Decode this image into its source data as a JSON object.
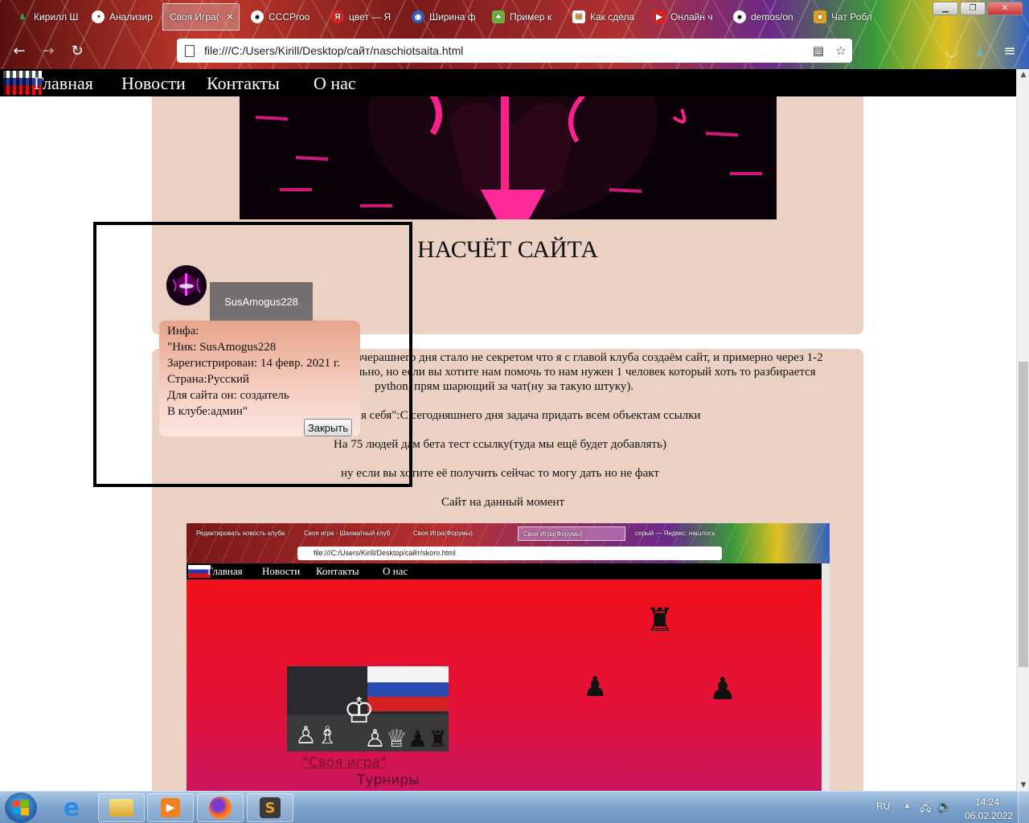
{
  "browser": {
    "tabs": [
      {
        "title": "Кирилл Ш",
        "icon": "person-icon",
        "color": "#3a9a3a"
      },
      {
        "title": "Анализир",
        "icon": "clock-icon",
        "color": "#ffffff"
      },
      {
        "title": "Своя Игра(",
        "icon": "none",
        "color": "#000000"
      },
      {
        "title": "CCCProo",
        "icon": "github-icon",
        "color": "#ffffff"
      },
      {
        "title": "цвет — Я",
        "icon": "yandex-icon",
        "color": "#e02020"
      },
      {
        "title": "Ширина ф",
        "icon": "globe-icon",
        "color": "#3060c0"
      },
      {
        "title": "Пример к",
        "icon": "frog-icon",
        "color": "#6ab040"
      },
      {
        "title": "Как сдела",
        "icon": "m-icon",
        "color": "#e0a020"
      },
      {
        "title": "Онлайн ч",
        "icon": "youtube-icon",
        "color": "#e02020"
      },
      {
        "title": "demos/on",
        "icon": "github-icon",
        "color": "#ffffff"
      },
      {
        "title": "Чат Робл",
        "icon": "roblox-icon",
        "color": "#e0a020"
      }
    ],
    "url": "file:///C:/Users/Kirill/Desktop/сайт/naschiotsaita.html"
  },
  "site": {
    "nav": [
      "Главная",
      "Новости",
      "Контакты",
      "О нас"
    ],
    "heading": "НАСЧЁТ САЙТА",
    "paragraphs": [
      "вчерашнего дня стало не секретом что я с главой клуба создаём сайт, и примерно через 1-2",
      "льно, но если вы хотите нам помочь то нам нужен 1 человек который хоть то разбирается",
      "python, прям шарющий за чат(ну за такую штуку).",
      "я себя\":С сегодняшнего дня задача придать всем объектам ссылки",
      "На 75 людей дам бета тест ссылку(туда мы ещё будет добавлять)",
      "ну если вы хотите её получить сейчас то могу дать но не факт",
      "Сайт на данный момент"
    ],
    "profile": {
      "nickname": "SusAmogus228",
      "info_lines": [
        "Инфа:",
        "\"Ник: SusAmogus228",
        "Зарегистрирован: 14 февр. 2021 г.",
        "Страна:Русский",
        "Для сайта он: создатель",
        "В клубе:админ\""
      ],
      "close_label": "Закрыть"
    },
    "embedded": {
      "tabs": [
        "Редактировать новость клуба",
        "Своя игра - Шахматный клуб",
        "Своя Игра(Форумы)",
        "Своя Игра(Форумы)",
        "серый — Яндекс: нашлось"
      ],
      "url": "file:///C:/Users/Kirill/Desktop/сайт/skoro.html",
      "nav": [
        "Главная",
        "Новости",
        "Контакты",
        "О нас"
      ],
      "game_link": "\"Своя игра\"",
      "tournaments": "Турниры"
    }
  },
  "taskbar": {
    "lang": "RU",
    "time": "14:24",
    "date": "06.02.2022"
  }
}
